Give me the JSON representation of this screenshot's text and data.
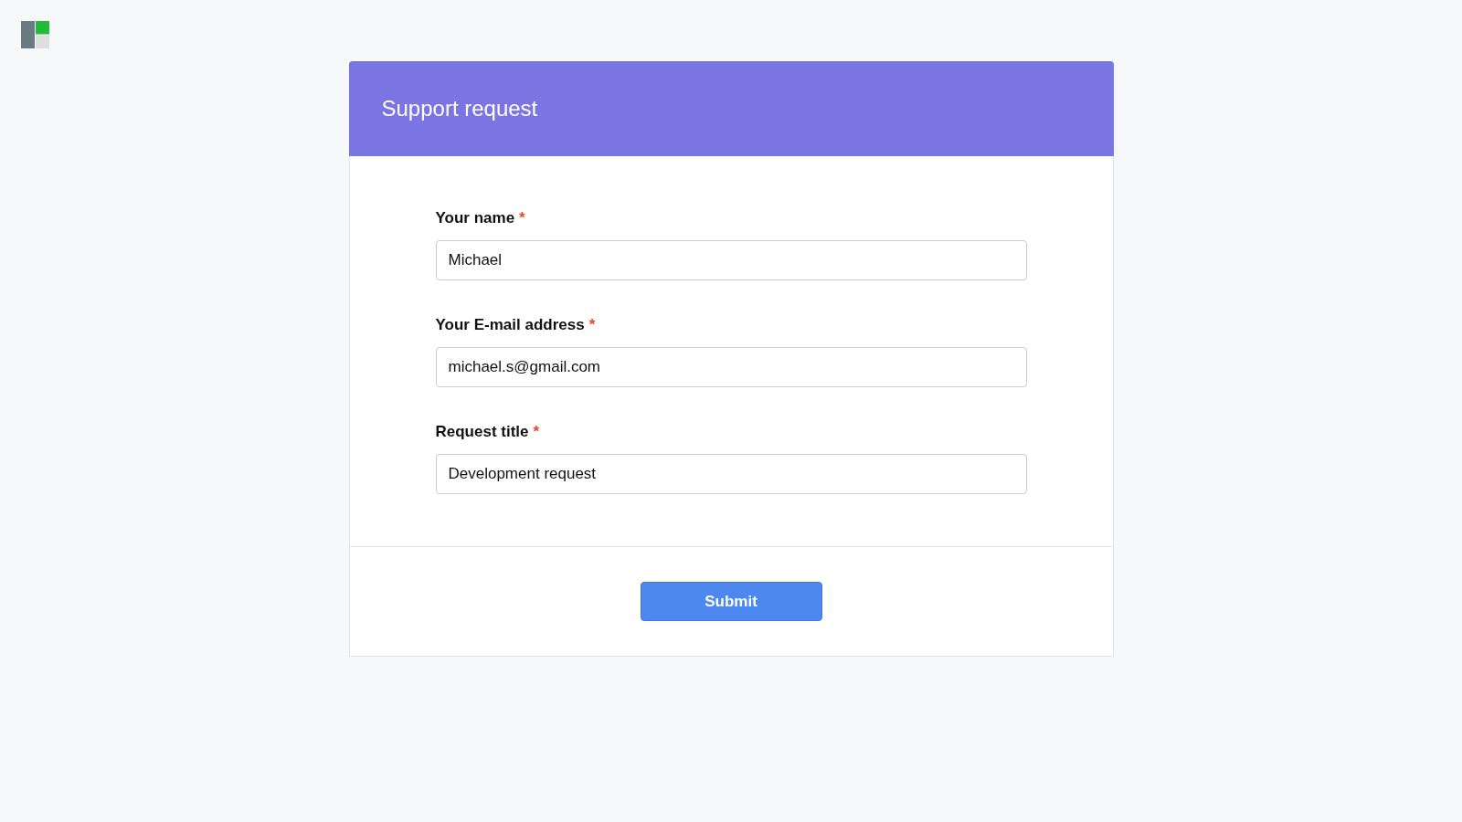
{
  "header": {
    "title": "Support request"
  },
  "fields": [
    {
      "label": "Your name",
      "required_mark": "*",
      "value": "Michael"
    },
    {
      "label": "Your E-mail address",
      "required_mark": "*",
      "value": "michael.s@gmail.com"
    },
    {
      "label": "Request title",
      "required_mark": "*",
      "value": "Development request"
    }
  ],
  "submit_button": {
    "label": "Submit"
  }
}
